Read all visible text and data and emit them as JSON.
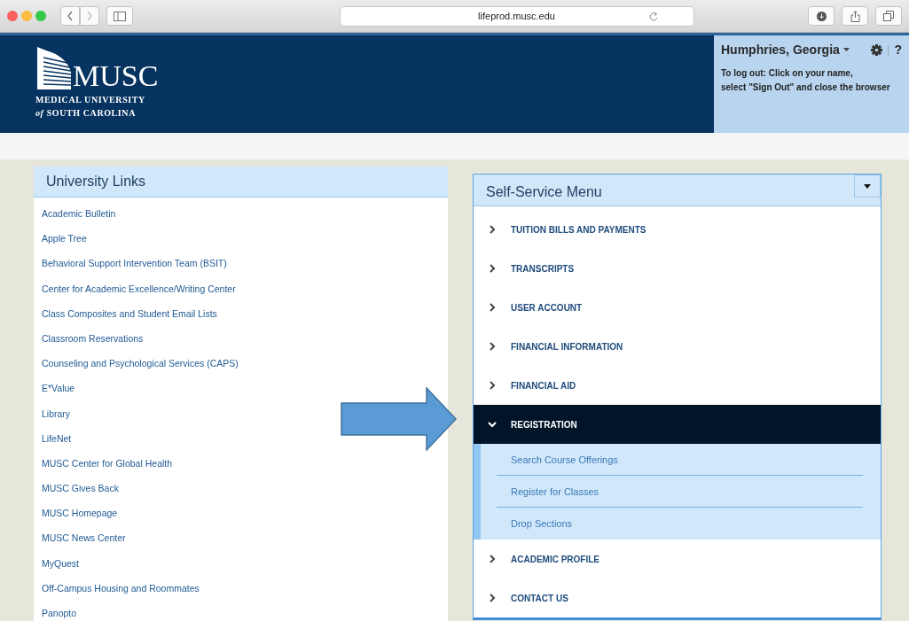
{
  "browser": {
    "address": "lifeprod.musc.edu"
  },
  "header": {
    "logo": {
      "wordmark": "MUSC",
      "line1": "MEDICAL UNIVERSITY",
      "line2": "*of* SOUTH CAROLINA"
    },
    "user": {
      "name": "Humphries, Georgia",
      "help": "?",
      "note": [
        "To log out: Click on your name,",
        "select \"Sign Out\" and close the browser"
      ]
    }
  },
  "university_links": {
    "title": "University Links",
    "items": [
      {
        "label": "Academic Bulletin"
      },
      {
        "label": "Apple Tree"
      },
      {
        "label": "Behavioral Support Intervention Team (BSIT)"
      },
      {
        "label": "Center for Academic Excellence/Writing Center"
      },
      {
        "label": "Class Composites and Student Email Lists"
      },
      {
        "label": "Classroom Reservations"
      },
      {
        "label": "Counseling and Psychological Services (CAPS)"
      },
      {
        "label": "E*Value"
      },
      {
        "label": "Library"
      },
      {
        "label": "LifeNet"
      },
      {
        "label": "MUSC Center for Global Health"
      },
      {
        "label": "MUSC Gives Back"
      },
      {
        "label": "MUSC Homepage"
      },
      {
        "label": "MUSC News Center"
      },
      {
        "label": "MyQuest"
      },
      {
        "label": "Off-Campus Housing and Roommates"
      },
      {
        "label": "Panopto"
      }
    ]
  },
  "self_service_menu": {
    "title": "Self-Service Menu",
    "items": [
      {
        "label": "TUITION BILLS AND PAYMENTS",
        "expanded": false
      },
      {
        "label": "TRANSCRIPTS",
        "expanded": false
      },
      {
        "label": "USER ACCOUNT",
        "expanded": false
      },
      {
        "label": "FINANCIAL INFORMATION",
        "expanded": false
      },
      {
        "label": "FINANCIAL AID",
        "expanded": false
      },
      {
        "label": "REGISTRATION",
        "expanded": true,
        "children": [
          {
            "label": "Search Course Offerings"
          },
          {
            "label": "Register for Classes"
          },
          {
            "label": "Drop Sections"
          }
        ]
      },
      {
        "label": "ACADEMIC PROFILE",
        "expanded": false
      },
      {
        "label": "CONTACT US",
        "expanded": false
      }
    ]
  }
}
